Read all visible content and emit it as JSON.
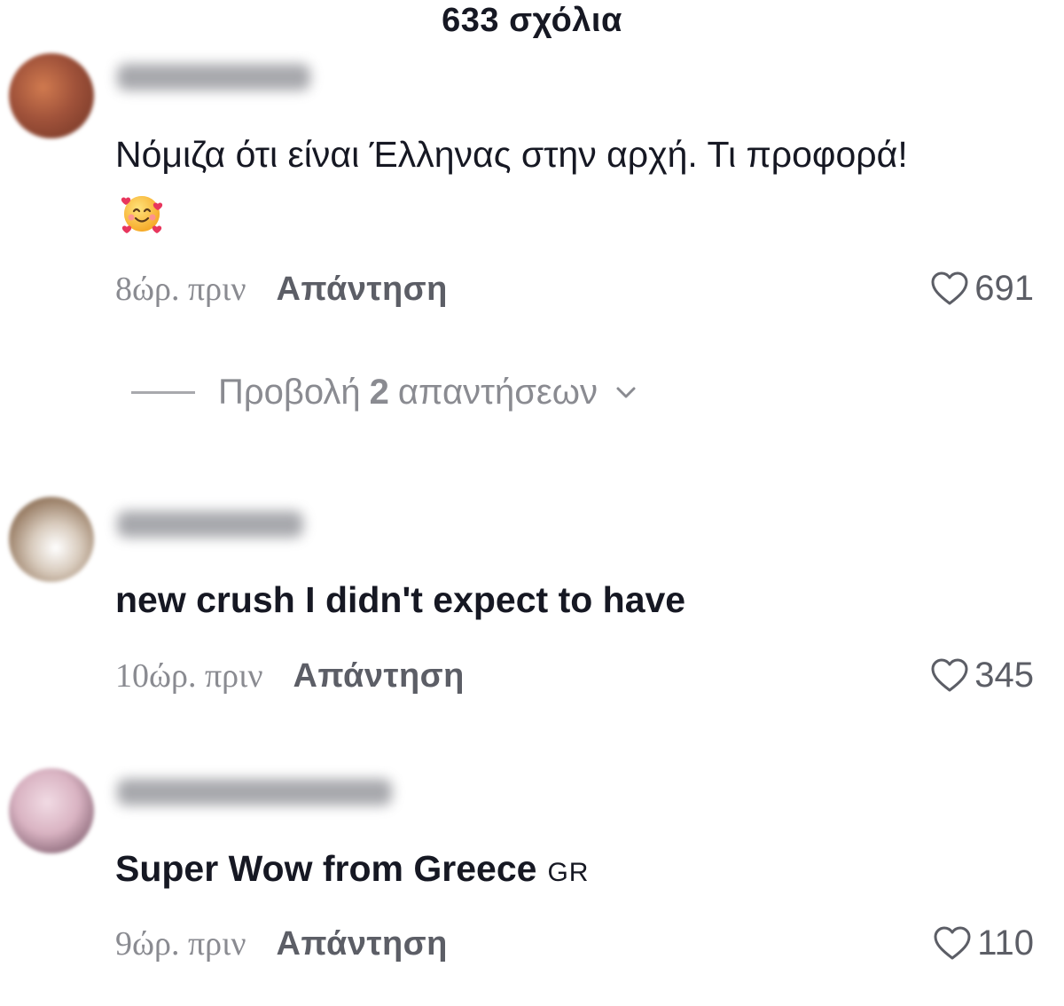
{
  "header": {
    "title": "633 σχόλια"
  },
  "comments": [
    {
      "text": "Νόμιζα ότι είναι Έλληνας στην αρχή. Τι προφορά!",
      "emoji": "smiling-face-with-hearts",
      "time": "8ώρ. πριν",
      "reply_label": "Απάντηση",
      "likes": "691",
      "avatar_color": "#a0523a"
    },
    {
      "text": "new crush I didn't expect to have",
      "time": "10ώρ. πριν",
      "reply_label": "Απάντηση",
      "likes": "345",
      "avatar_color": "#b9a48f"
    },
    {
      "text": "Super Wow from Greece",
      "flag": "GR",
      "time": "9ώρ. πριν",
      "reply_label": "Απάντηση",
      "likes": "110",
      "avatar_color": "#d9b3c2"
    }
  ],
  "view_replies": {
    "prefix": "Προβολή",
    "count": "2",
    "suffix": "απαντήσεων"
  },
  "colors": {
    "primary_text": "#161823",
    "secondary_text": "#8a8b91",
    "action_text": "#5c5e66"
  }
}
